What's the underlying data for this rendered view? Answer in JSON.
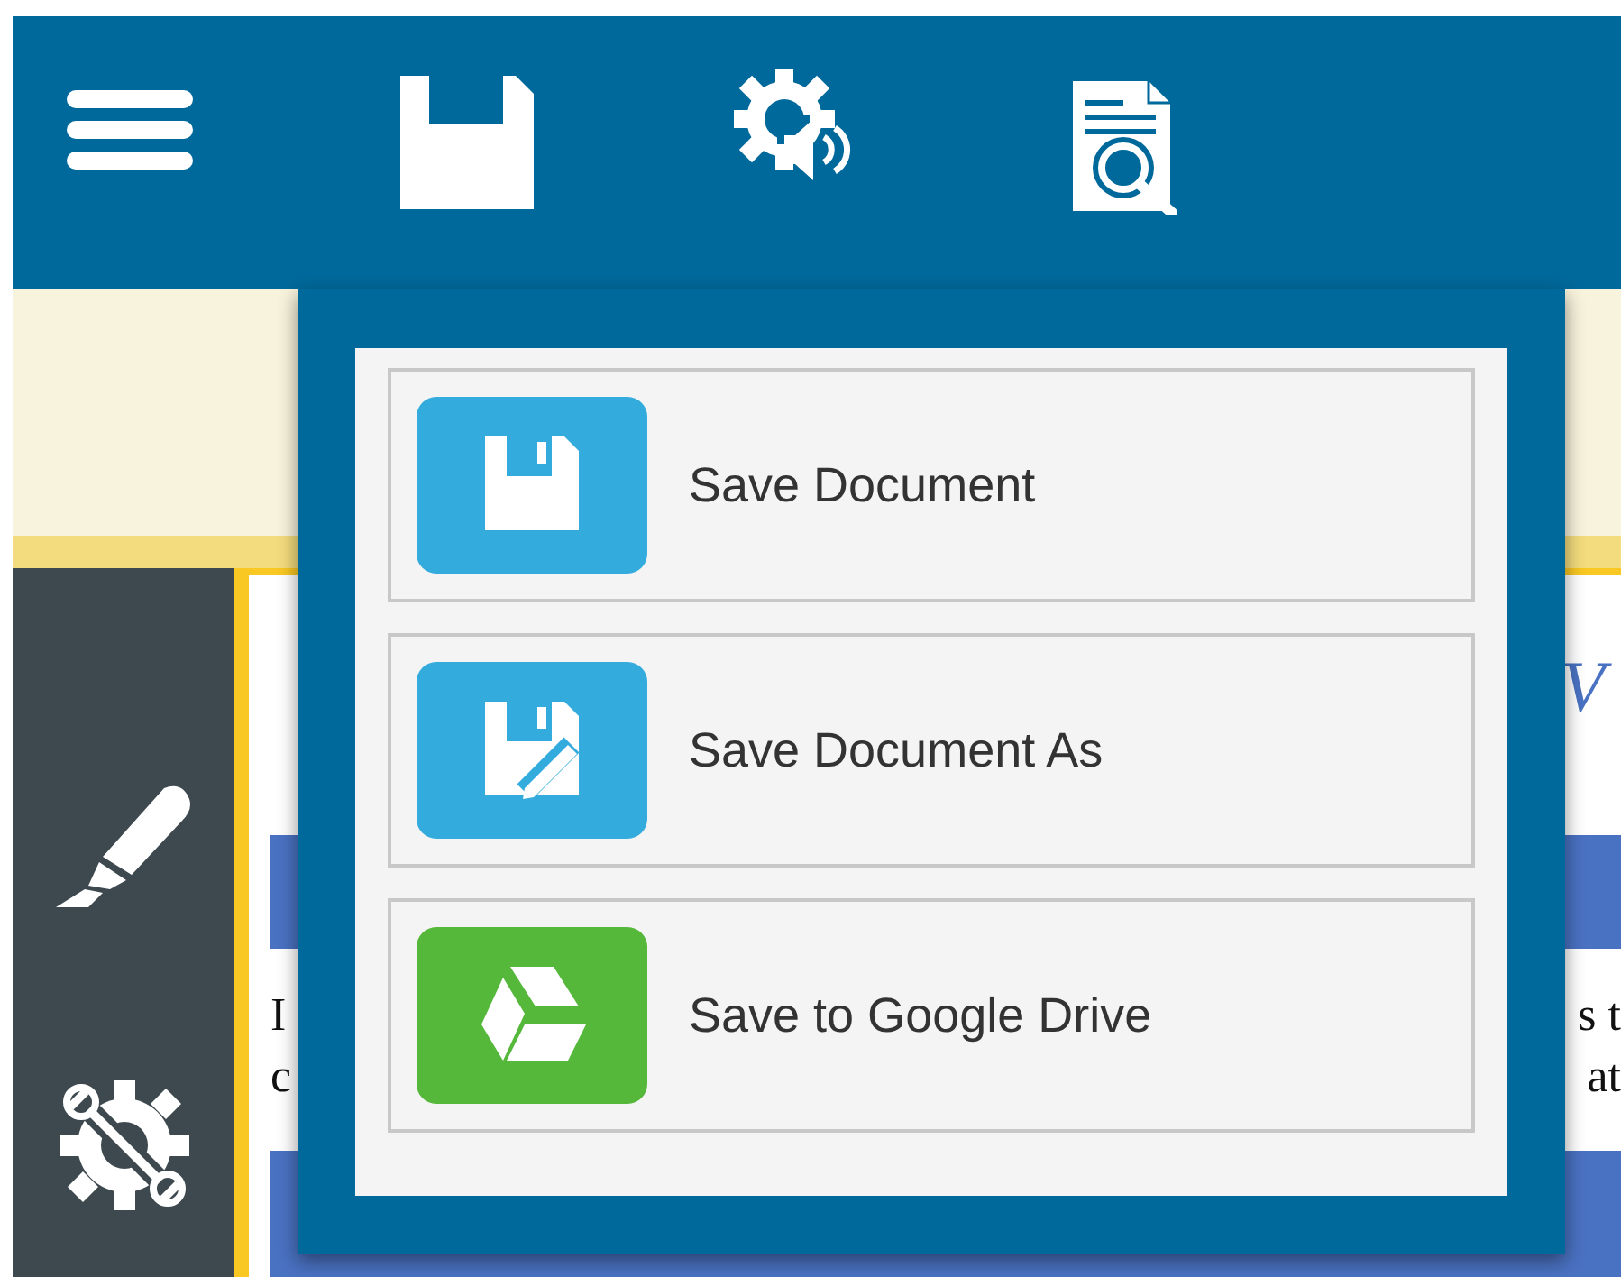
{
  "document": {
    "heading_fragment": "V",
    "lines": [
      {
        "left": "I",
        "right": "s t"
      },
      {
        "left": "c",
        "right": "at"
      }
    ]
  },
  "save_menu": {
    "items": [
      {
        "kind": "save",
        "label": "Save Document",
        "color": "#33abdd"
      },
      {
        "kind": "save_as",
        "label": "Save Document As",
        "color": "#33abdd"
      },
      {
        "kind": "drive",
        "label": "Save to Google Drive",
        "color": "#55b83a"
      }
    ]
  }
}
